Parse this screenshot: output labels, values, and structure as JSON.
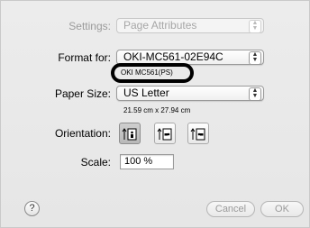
{
  "settings": {
    "label": "Settings:",
    "value": "Page Attributes"
  },
  "format_for": {
    "label": "Format for:",
    "value": "OKI-MC561-02E94C",
    "sub": "OKI MC561(PS)"
  },
  "paper_size": {
    "label": "Paper Size:",
    "value": "US Letter",
    "sub": "21.59 cm x 27.94 cm"
  },
  "orientation": {
    "label": "Orientation:",
    "options": [
      {
        "name": "portrait",
        "selected": true
      },
      {
        "name": "landscape-left",
        "selected": false
      },
      {
        "name": "landscape-right",
        "selected": false
      }
    ]
  },
  "scale": {
    "label": "Scale:",
    "value": "100 %"
  },
  "buttons": {
    "help": "?",
    "cancel": "Cancel",
    "ok": "OK"
  }
}
